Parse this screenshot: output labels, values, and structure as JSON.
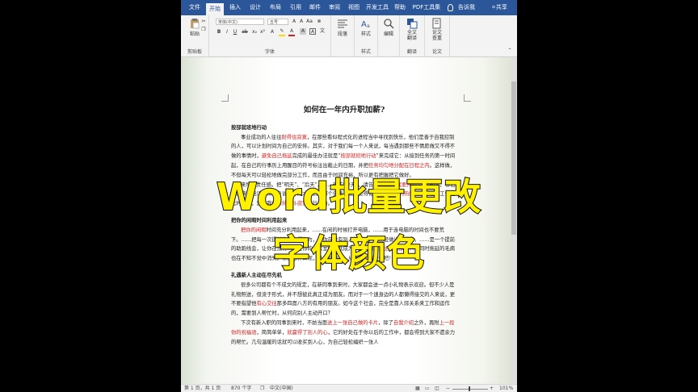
{
  "ribbon": {
    "tabs": [
      "文件",
      "开始",
      "插入",
      "设计",
      "布局",
      "引用",
      "邮件",
      "审阅",
      "视图",
      "开发工具",
      "帮助",
      "PDF工具集"
    ],
    "active_tab": "开始",
    "tell_me": "告诉我",
    "share": "共享",
    "groups": {
      "clipboard": {
        "paste": "粘贴",
        "label": "剪贴板"
      },
      "font": {
        "font_name": "宋体(中文)",
        "font_size": "五号",
        "label": "字体"
      },
      "paragraph": {
        "button": "段落"
      },
      "styles": {
        "button": "样式",
        "label": "样式"
      },
      "editing": {
        "button": "编辑"
      },
      "translate": {
        "button_line1": "全文",
        "button_line2": "翻译",
        "label": "翻译"
      },
      "proofing": {
        "button_line1": "论文",
        "button_line2": "查重",
        "label": "论文"
      }
    }
  },
  "document": {
    "title": "如何在一年内升职加薪?",
    "section1": {
      "heading": "按部就班地行动",
      "p1": [
        {
          "t": "事业成功的人往往"
        },
        {
          "t": "耐得住寂寞",
          "red": true
        },
        {
          "t": "，在那些看似程式化的进程当中寻找到快乐，他们是善于自我控制的人，可以计划时间为自己的安排。其实，对于我们每一个人来说，每当遇到那些不情愿做又不得不做的事情时，"
        },
        {
          "t": "避免自己拖延",
          "red": true
        },
        {
          "t": "完成的最佳办法就是“"
        },
        {
          "t": "按部就班地行动",
          "red": true
        },
        {
          "t": "”来完成它：从接到任务的第一时间起，在自己的行事历上用醒目的符号标注出截止的日期，并把"
        },
        {
          "t": "任务均匀地分配在日程之内",
          "red": true
        },
        {
          "t": "。这样做，不但每天可以轻松地做完部分工作，而且由于时间充裕，所以更有把握把它做好。"
        }
      ],
      "p2": [
        {
          "t": "来增加责任感。把“明天”、“后天”、……改成“今天”，请告诉自己：“"
        },
        {
          "t": "我要开始工作",
          "red": true
        },
        {
          "t": "”的人，哪怕只是拿起电话，和客户说说你刚才想到的那个创意，让他觉得你是一个"
        },
        {
          "t": "主动的热情的服务者",
          "red": true
        },
        {
          "t": "。工作在此时此刻，是让我们"
        },
        {
          "t": "保持奋斗欲望",
          "red": true
        },
        {
          "t": "的行动力。"
        }
      ]
    },
    "section2": {
      "heading": "把你的闲暇时间利用起来",
      "p1": [
        {
          "t": "把你的闲暇",
          "red": true
        },
        {
          "t": "时间充分利用起来，……在闲的时候打开电脑，……用于连电脑的时间也不要荒下。……把每一次提前的助跑视作为，让你在没有别人督促下，就已经做出了成果，……是一个提前的助跑线会，让你在没有……在你的办公室中你就成为了工作面前"
        },
        {
          "t": "最主动的那个人",
          "red": true
        },
        {
          "t": "，同时拖延的毛病也在不知不觉中消失。你还想什么呢，马上就动手，从"
        },
        {
          "t": "找快乐事",
          "red": true
        },
        {
          "t": "开始吧！"
        }
      ]
    },
    "section3": {
      "heading": "礼遇新人主动在尽先机",
      "p1": [
        {
          "t": "很多公司都有个不成文的规定，在新同事到来时，大家都会送一点小礼物表示欢迎。但不少人是礼物照送，但流于形式，并不想彼此真正成为朋友。而对于一个速身边的人都懒得接交的人来说，更不要指望他"
        },
        {
          "t": "有心交往",
          "red": true
        },
        {
          "t": "那多四面八方的有用的朋友。如今这个社会，完全是靠人际关系来工作和运作的，需要到人帮忙时，从何向别人主动开口？"
        }
      ],
      "p2": [
        {
          "t": "下次有新入职的同事到来时，不妨当面"
        },
        {
          "t": "送上一张自己做的卡片",
          "red": true
        },
        {
          "t": "，除了"
        },
        {
          "t": "自我介绍",
          "red": true
        },
        {
          "t": "之外，再附"
        },
        {
          "t": "上一段你的祝福语",
          "red": true
        },
        {
          "t": "，简简单单，"
        },
        {
          "t": "就赢得了别人的心",
          "red": true
        },
        {
          "t": "，它的好处在于你以后的工作中，都会得到大家不遗余力的帮忙。几句温暖的话就可以收买到人心，为自己轻松编织一张人"
        }
      ]
    }
  },
  "status": {
    "page": "第 1 页，共 1 页",
    "words": "870 个字",
    "lang": "中文(中国)",
    "zoom": "101%"
  },
  "overlay": {
    "line1": "Word批量更改",
    "line2": "字体颜色"
  },
  "colors": {
    "ribbon_blue": "#2b579a",
    "red_text": "#d42020",
    "caption_yellow": "#fff100"
  }
}
